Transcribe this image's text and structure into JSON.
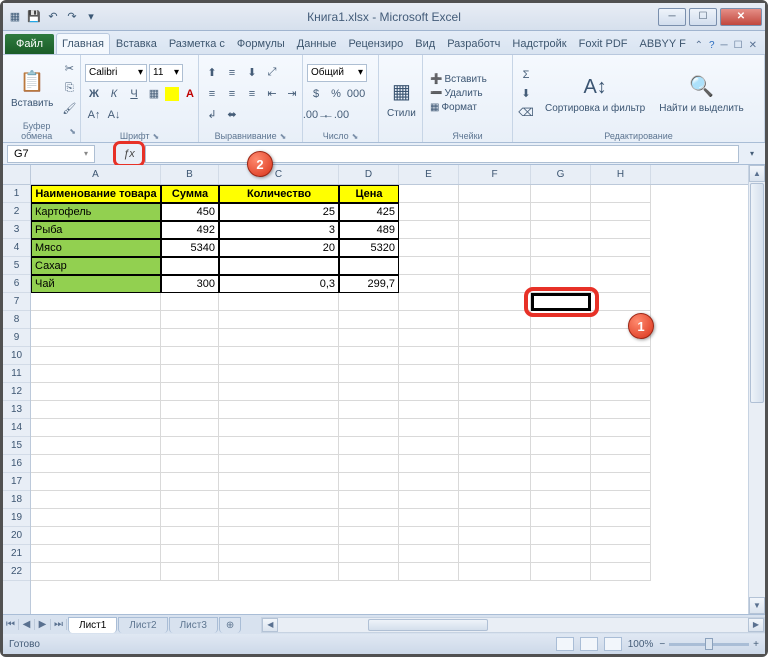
{
  "title": "Книга1.xlsx - Microsoft Excel",
  "tabs": {
    "file": "Файл",
    "home": "Главная",
    "insert": "Вставка",
    "layout": "Разметка с",
    "formulas": "Формулы",
    "data": "Данные",
    "review": "Рецензиро",
    "view": "Вид",
    "dev": "Разработч",
    "addins": "Надстройк",
    "foxit": "Foxit PDF",
    "abbyy": "ABBYY F"
  },
  "groups": {
    "clipboard": "Буфер обмена",
    "font": "Шрифт",
    "align": "Выравнивание",
    "number": "Число",
    "styles": "Стили",
    "cells": "Ячейки",
    "editing": "Редактирование"
  },
  "clipboard": {
    "paste": "Вставить"
  },
  "font": {
    "name": "Calibri",
    "size": "11",
    "bold": "Ж",
    "italic": "К",
    "underline": "Ч"
  },
  "number": {
    "format": "Общий"
  },
  "styles": {
    "main": "Стили"
  },
  "cells": {
    "insert": "Вставить",
    "delete": "Удалить",
    "format": "Формат"
  },
  "editing": {
    "sort": "Сортировка и фильтр",
    "find": "Найти и выделить"
  },
  "namebox": "G7",
  "cols": [
    "A",
    "B",
    "C",
    "D",
    "E",
    "F",
    "G",
    "H"
  ],
  "rows": [
    "1",
    "2",
    "3",
    "4",
    "5",
    "6",
    "7",
    "8",
    "9",
    "10",
    "11",
    "12",
    "13",
    "14",
    "15",
    "16",
    "17",
    "18",
    "19",
    "20",
    "21",
    "22"
  ],
  "headers": {
    "name": "Наименование товара",
    "sum": "Сумма",
    "qty": "Количество",
    "price": "Цена"
  },
  "data": [
    {
      "name": "Картофель",
      "sum": "450",
      "qty": "25",
      "price": "425"
    },
    {
      "name": "Рыба",
      "sum": "492",
      "qty": "3",
      "price": "489"
    },
    {
      "name": "Мясо",
      "sum": "5340",
      "qty": "20",
      "price": "5320"
    },
    {
      "name": "Сахар",
      "sum": "",
      "qty": "",
      "price": ""
    },
    {
      "name": "Чай",
      "sum": "300",
      "qty": "0,3",
      "price": "299,7"
    }
  ],
  "sheets": {
    "s1": "Лист1",
    "s2": "Лист2",
    "s3": "Лист3"
  },
  "status": "Готово",
  "zoom": "100%",
  "callout1": "1",
  "callout2": "2"
}
